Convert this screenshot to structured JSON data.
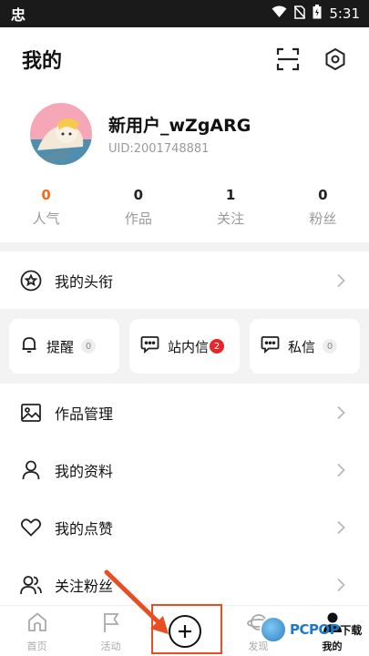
{
  "status_bar": {
    "carrier_glyph": "忠",
    "time": "5:31"
  },
  "header": {
    "title": "我的"
  },
  "profile": {
    "username": "新用户_wZgARG",
    "uid": "UID:2001748881"
  },
  "stats": [
    {
      "value": "0",
      "label": "人气"
    },
    {
      "value": "0",
      "label": "作品"
    },
    {
      "value": "1",
      "label": "关注"
    },
    {
      "value": "0",
      "label": "粉丝"
    }
  ],
  "title_row": {
    "label": "我的头衔"
  },
  "messages": [
    {
      "label": "提醒",
      "count": "0"
    },
    {
      "label": "站内信",
      "count": "2"
    },
    {
      "label": "私信",
      "count": "0"
    }
  ],
  "menu": [
    {
      "label": "作品管理"
    },
    {
      "label": "我的资料"
    },
    {
      "label": "我的点赞"
    },
    {
      "label": "关注粉丝"
    }
  ],
  "tabbar": [
    {
      "label": "首页"
    },
    {
      "label": "活动"
    },
    {
      "label": ""
    },
    {
      "label": "发现"
    },
    {
      "label": "我的"
    }
  ],
  "watermark": {
    "text": "PCPOP",
    "sub": "下载"
  },
  "colors": {
    "accent": "#f26b1d",
    "badge": "#e8262a",
    "highlight": "#e84e21"
  }
}
